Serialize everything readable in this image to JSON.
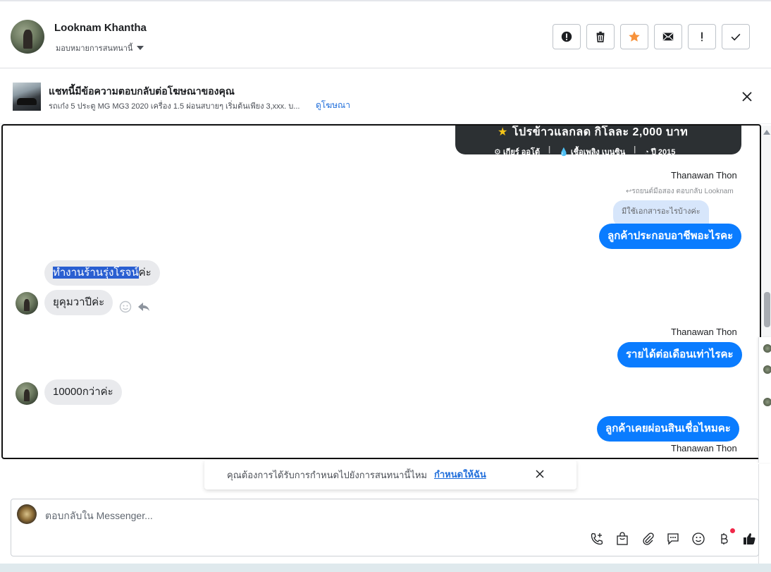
{
  "header": {
    "contact_name": "Looknam Khantha",
    "assign_label": "มอบหมายการสนทนานี้",
    "actions": [
      {
        "name": "alert-icon",
        "label": "alert"
      },
      {
        "name": "trash-icon",
        "label": "delete"
      },
      {
        "name": "star-icon",
        "label": "star"
      },
      {
        "name": "envelope-icon",
        "label": "mark unread"
      },
      {
        "name": "exclamation-icon",
        "label": "spam"
      },
      {
        "name": "check-icon",
        "label": "done"
      }
    ]
  },
  "ad_banner": {
    "title": "แชทนี้มีข้อความตอบกลับต่อโฆษณาของคุณ",
    "description": "รถเก๋ง 5 ประตู MG MG3 2020 เครื่อง 1.5 ผ่อนสบายๆ เริ่มต้นเพียง 3,xxx. บ...",
    "link": "ดูโฆษณา"
  },
  "ad_card": {
    "headline": "โปรข้าวแลกลด กิโลละ 2,000 บาท",
    "specs": [
      "⚙ เกียร์ ออโต้",
      "💧 เชื้อเพลิง เบนซิน",
      "◔ ปี 2015"
    ]
  },
  "conversation": {
    "sender_1": "Thanawan Thon",
    "reply_note": "↩รถยนต์มือสอง ตอบกลับ Looknam",
    "quoted_text": "มีใช้เอกสารอะไรบ้างค่ะ",
    "out_1": "ลูกค้าประกอบอาชีพอะไรคะ",
    "in_1_selected": "ทำงานร้านรุ่งโรจน์",
    "in_1_rest": "ค่ะ",
    "in_2": "ยุคุมวาปีค่ะ",
    "sender_2": "Thanawan Thon",
    "out_2": "รายได้ต่อเดือนเท่าไรคะ",
    "in_3": "10000กว่าค่ะ",
    "out_3": "ลูกค้าเคยผ่อนสินเชื่อไหมคะ",
    "sender_3": "Thanawan Thon"
  },
  "reminder": {
    "text": "คุณต้องการได้รับการกำหนดไปยังการสนทนานี้ไหม",
    "link": "กำหนดให้ฉัน"
  },
  "composer": {
    "placeholder": "ตอบกลับใน Messenger..."
  },
  "colors": {
    "outgoing_bubble": "#0a7cff",
    "incoming_bubble": "#e9eaed",
    "link": "#216fdb",
    "star_active": "#f7923b"
  }
}
